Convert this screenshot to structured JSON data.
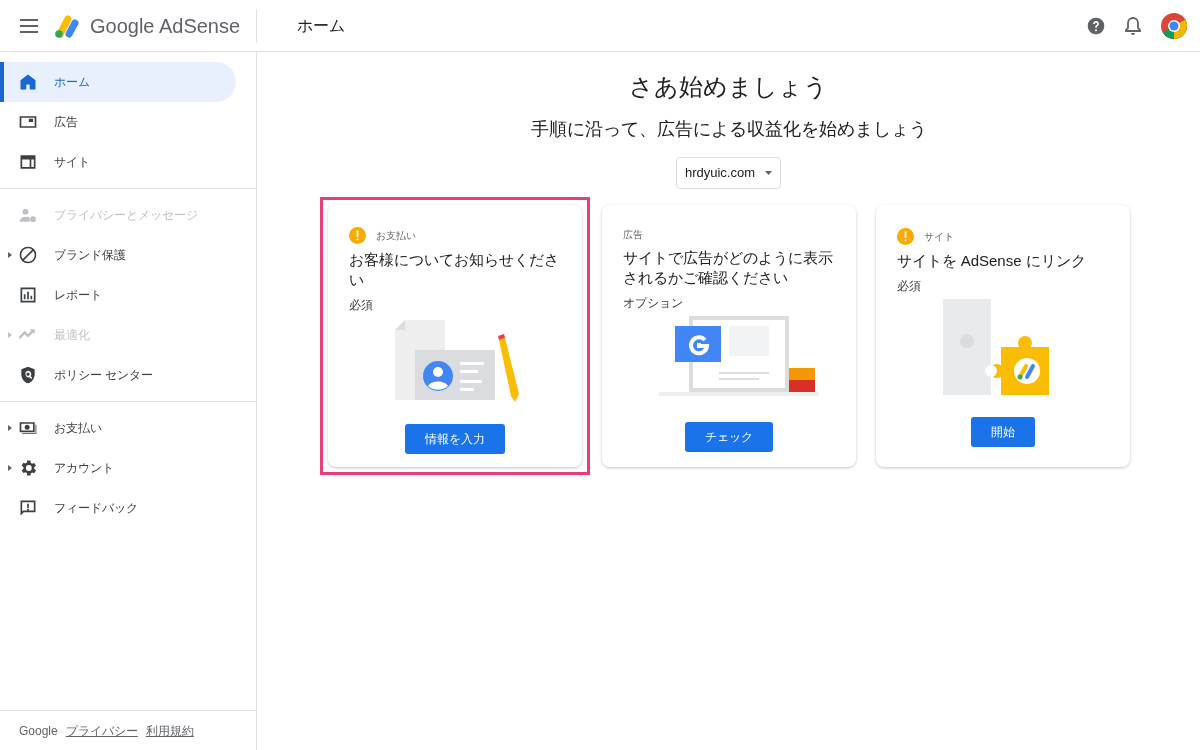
{
  "header": {
    "product": "Google AdSense",
    "page_title": "ホーム"
  },
  "sidebar": {
    "groups": [
      {
        "items": [
          {
            "label": "ホーム",
            "selected": true,
            "disabled": false,
            "expandable": false
          },
          {
            "label": "広告",
            "selected": false,
            "disabled": false,
            "expandable": false
          },
          {
            "label": "サイト",
            "selected": false,
            "disabled": false,
            "expandable": false
          }
        ]
      },
      {
        "items": [
          {
            "label": "プライバシーとメッセージ",
            "selected": false,
            "disabled": true,
            "expandable": false
          },
          {
            "label": "ブランド保護",
            "selected": false,
            "disabled": false,
            "expandable": true
          },
          {
            "label": "レポート",
            "selected": false,
            "disabled": false,
            "expandable": false
          },
          {
            "label": "最適化",
            "selected": false,
            "disabled": true,
            "expandable": true
          },
          {
            "label": "ポリシー センター",
            "selected": false,
            "disabled": false,
            "expandable": false
          }
        ]
      },
      {
        "items": [
          {
            "label": "お支払い",
            "selected": false,
            "disabled": false,
            "expandable": true
          },
          {
            "label": "アカウント",
            "selected": false,
            "disabled": false,
            "expandable": true
          },
          {
            "label": "フィードバック",
            "selected": false,
            "disabled": false,
            "expandable": false
          }
        ]
      }
    ],
    "footer": {
      "brand": "Google",
      "links": [
        "プライバシー",
        "利用規約"
      ]
    }
  },
  "main": {
    "title": "さあ始めましょう",
    "subtitle": "手順に沿って、広告による収益化を始めましょう",
    "site_select": "hrdyuic.com",
    "cards": [
      {
        "category": "お支払い",
        "warning": true,
        "highlighted": true,
        "title": "お客様についてお知らせください",
        "status": "必須",
        "button": "情報を入力"
      },
      {
        "category": "広告",
        "warning": false,
        "highlighted": false,
        "title": "サイトで広告がどのように表示されるかご確認ください",
        "status": "オプション",
        "button": "チェック"
      },
      {
        "category": "サイト",
        "warning": true,
        "highlighted": false,
        "title": "サイトを AdSense にリンク",
        "status": "必須",
        "button": "開始"
      }
    ]
  }
}
